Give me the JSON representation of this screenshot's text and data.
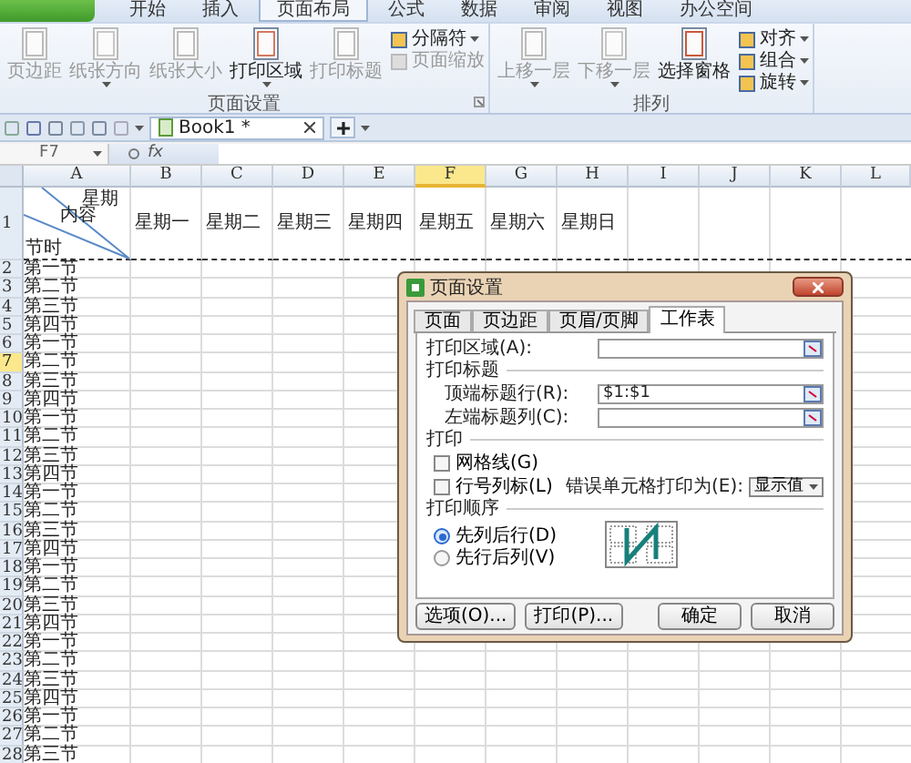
{
  "menu_tabs": [
    {
      "label": "开始",
      "selected": false
    },
    {
      "label": "插入",
      "selected": false
    },
    {
      "label": "页面布局",
      "selected": true
    },
    {
      "label": "公式",
      "selected": false
    },
    {
      "label": "数据",
      "selected": false
    },
    {
      "label": "审阅",
      "selected": false
    },
    {
      "label": "视图",
      "selected": false
    },
    {
      "label": "办公空间",
      "selected": false
    }
  ],
  "ribbon": [
    {
      "label": "页面设置",
      "launcher": true,
      "items": [
        {
          "kind": "large",
          "label": "页边距",
          "disabled": true,
          "dropdown": false
        },
        {
          "kind": "large",
          "label": "纸张方向",
          "disabled": true,
          "dropdown": true
        },
        {
          "kind": "large",
          "label": "纸张大小",
          "disabled": true,
          "dropdown": false
        },
        {
          "kind": "large",
          "label": "打印区域",
          "disabled": false,
          "dropdown": true
        },
        {
          "kind": "large",
          "label": "打印标题",
          "disabled": true,
          "dropdown": false
        },
        {
          "kind": "small",
          "label": "分隔符",
          "disabled": false,
          "dropdown": true
        },
        {
          "kind": "small",
          "label": "页面缩放",
          "disabled": true,
          "dropdown": false
        }
      ]
    },
    {
      "label": "排列",
      "items": [
        {
          "kind": "large",
          "label": "上移一层",
          "disabled": true,
          "dropdown": true
        },
        {
          "kind": "large",
          "label": "下移一层",
          "disabled": true,
          "dropdown": true
        },
        {
          "kind": "large",
          "label": "选择窗格",
          "disabled": false,
          "dropdown": false
        },
        {
          "kind": "small",
          "label": "对齐",
          "disabled": false,
          "dropdown": true
        },
        {
          "kind": "small",
          "label": "组合",
          "disabled": false,
          "dropdown": true
        },
        {
          "kind": "small",
          "label": "旋转",
          "disabled": false,
          "dropdown": true
        }
      ]
    }
  ],
  "doc_tabs": [
    {
      "label": "Book1 *",
      "selected": true
    }
  ],
  "formula_bar": {
    "name_box": "F7",
    "fx": "fx"
  },
  "columns": [
    {
      "label": "A",
      "selected": false
    },
    {
      "label": "B",
      "selected": false
    },
    {
      "label": "C",
      "selected": false
    },
    {
      "label": "D",
      "selected": false
    },
    {
      "label": "E",
      "selected": false
    },
    {
      "label": "F",
      "selected": true
    },
    {
      "label": "G",
      "selected": false
    },
    {
      "label": "H",
      "selected": false
    },
    {
      "label": "I",
      "selected": false
    },
    {
      "label": "J",
      "selected": false
    },
    {
      "label": "K",
      "selected": false
    },
    {
      "label": "L",
      "selected": false
    }
  ],
  "header_row": {
    "number": "1",
    "selected": false,
    "corner_top": "星期",
    "corner_middle": "内容",
    "corner_bottom": "节时",
    "days": [
      "星期一",
      "星期二",
      "星期三",
      "星期四",
      "星期五",
      "星期六",
      "星期日"
    ]
  },
  "rows": [
    {
      "number": "2",
      "selected": false,
      "cell": "第一节"
    },
    {
      "number": "3",
      "selected": false,
      "cell": "第二节"
    },
    {
      "number": "4",
      "selected": false,
      "cell": "第三节"
    },
    {
      "number": "5",
      "selected": false,
      "cell": "第四节"
    },
    {
      "number": "6",
      "selected": false,
      "cell": "第一节"
    },
    {
      "number": "7",
      "selected": true,
      "cell": "第二节"
    },
    {
      "number": "8",
      "selected": false,
      "cell": "第三节"
    },
    {
      "number": "9",
      "selected": false,
      "cell": "第四节"
    },
    {
      "number": "10",
      "selected": false,
      "cell": "第一节"
    },
    {
      "number": "11",
      "selected": false,
      "cell": "第二节"
    },
    {
      "number": "12",
      "selected": false,
      "cell": "第三节"
    },
    {
      "number": "13",
      "selected": false,
      "cell": "第四节"
    },
    {
      "number": "14",
      "selected": false,
      "cell": "第一节"
    },
    {
      "number": "15",
      "selected": false,
      "cell": "第二节"
    },
    {
      "number": "16",
      "selected": false,
      "cell": "第三节"
    },
    {
      "number": "17",
      "selected": false,
      "cell": "第四节"
    },
    {
      "number": "18",
      "selected": false,
      "cell": "第一节"
    },
    {
      "number": "19",
      "selected": false,
      "cell": "第二节"
    },
    {
      "number": "20",
      "selected": false,
      "cell": "第三节"
    },
    {
      "number": "21",
      "selected": false,
      "cell": "第四节"
    },
    {
      "number": "22",
      "selected": false,
      "cell": "第一节"
    },
    {
      "number": "23",
      "selected": false,
      "cell": "第二节"
    },
    {
      "number": "24",
      "selected": false,
      "cell": "第三节"
    },
    {
      "number": "25",
      "selected": false,
      "cell": "第四节"
    },
    {
      "number": "26",
      "selected": false,
      "cell": "第一节"
    },
    {
      "number": "27",
      "selected": false,
      "cell": "第二节"
    },
    {
      "number": "28",
      "selected": false,
      "cell": "第三节"
    }
  ],
  "dialog": {
    "title": "页面设置",
    "tabs": [
      {
        "label": "页面",
        "selected": false
      },
      {
        "label": "页边距",
        "selected": false
      },
      {
        "label": "页眉/页脚",
        "selected": false
      },
      {
        "label": "工作表",
        "selected": true
      }
    ],
    "print_area": {
      "label": "打印区域(A):"
    },
    "titles_section": "打印标题",
    "title_fields": [
      {
        "label": "顶端标题行(R):",
        "value": "$1:$1"
      },
      {
        "label": "左端标题列(C):"
      }
    ],
    "print_section": "打印",
    "checkboxes": [
      {
        "label": "网格线(G)",
        "checked": false
      },
      {
        "label": "行号列标(L)",
        "checked": false
      }
    ],
    "errors": {
      "label": "错误单元格打印为(E):",
      "value": "显示值"
    },
    "order_section": "打印顺序",
    "order": [
      {
        "label": "先列后行(D)",
        "selected": true
      },
      {
        "label": "先行后列(V)",
        "selected": false
      }
    ],
    "buttons": [
      {
        "label": "选项(O)...",
        "kind": "left"
      },
      {
        "label": "打印(P)...",
        "kind": "left"
      },
      {
        "label": "确定",
        "kind": "right"
      },
      {
        "label": "取消",
        "kind": "right"
      }
    ]
  }
}
